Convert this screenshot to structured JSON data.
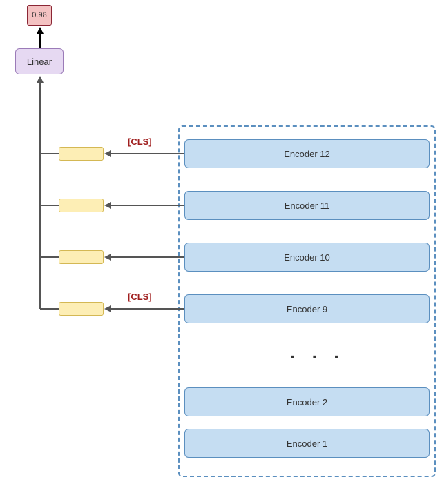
{
  "output": {
    "value": "0.98"
  },
  "linear": {
    "label": "Linear"
  },
  "cls_labels": {
    "top": "[CLS]",
    "mid": "[CLS]"
  },
  "encoders": {
    "e12": "Encoder 12",
    "e11": "Encoder 11",
    "e10": "Encoder 10",
    "e9": "Encoder 9",
    "e2": "Encoder 2",
    "e1": "Encoder 1"
  },
  "ellipsis": ". . ."
}
